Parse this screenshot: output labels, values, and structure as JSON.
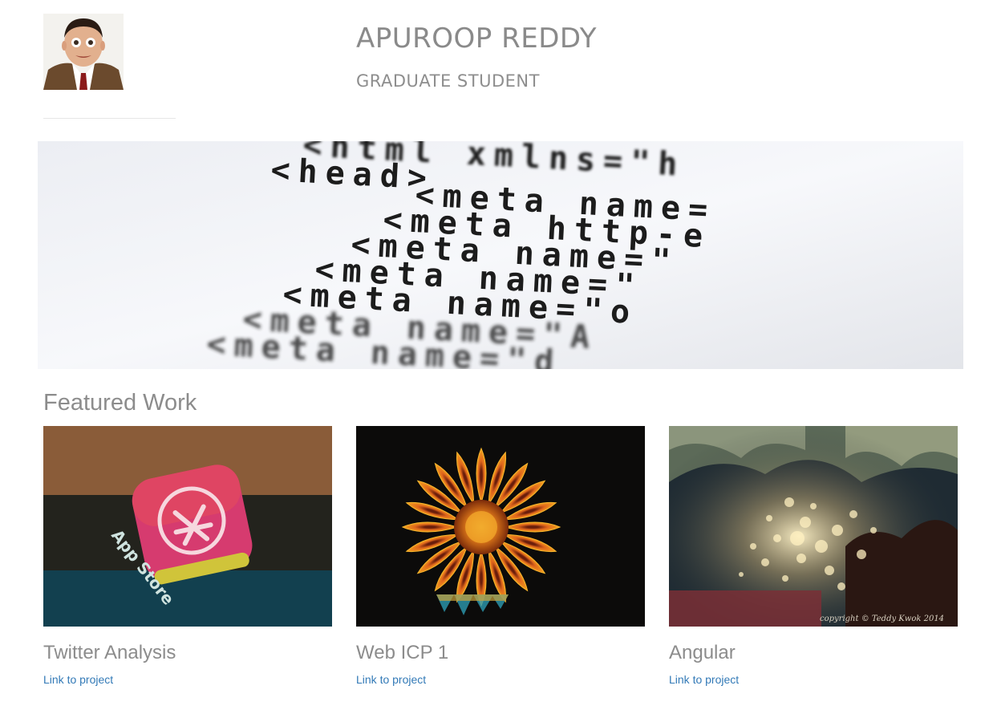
{
  "header": {
    "name": "APUROOP REDDY",
    "subtitle": "GRADUATE STUDENT"
  },
  "banner": {
    "code_lines": [
      "<html xmlns=\"h",
      "<head>",
      "<meta name=",
      "<meta http-e",
      "<meta name=\"",
      "<meta name=\"",
      "<meta name=\"o",
      "<meta name=\"A",
      "<meta name=\"d"
    ]
  },
  "featured": {
    "title": "Featured Work",
    "projects": [
      {
        "title": "Twitter Analysis",
        "link_label": "Link to project",
        "image_text": "App Store"
      },
      {
        "title": "Web ICP 1",
        "link_label": "Link to project"
      },
      {
        "title": "Angular",
        "link_label": "Link to project",
        "image_text": "copyright © Teddy Kwok 2014"
      }
    ]
  },
  "colors": {
    "heading_gray": "#8c8c8c",
    "link_blue": "#337ab7"
  }
}
